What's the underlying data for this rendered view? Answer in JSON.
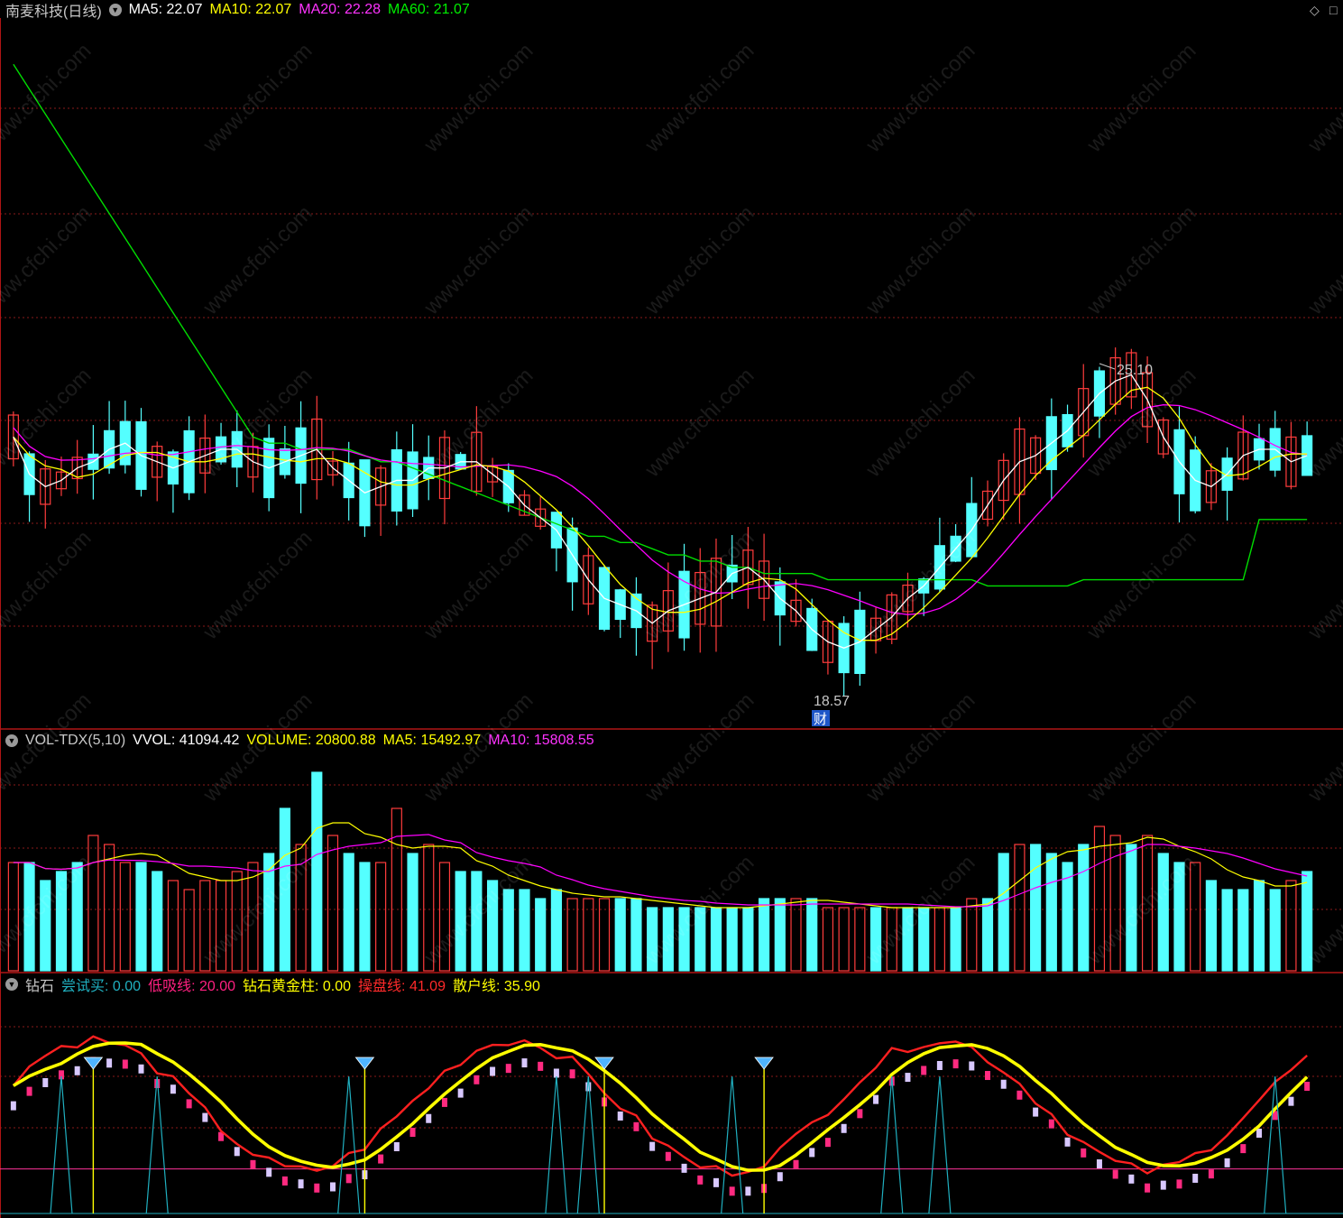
{
  "main": {
    "title": "南麦科技(日线)",
    "ma5": {
      "label": "MA5:",
      "value": "22.07",
      "color": "#ffffff"
    },
    "ma10": {
      "label": "MA10:",
      "value": "22.07",
      "color": "#ffff00"
    },
    "ma20": {
      "label": "MA20:",
      "value": "22.28",
      "color": "#ff00ff"
    },
    "ma60": {
      "label": "MA60:",
      "value": "21.07",
      "color": "#00ff00"
    },
    "high_label": "25.10",
    "low_label": "18.57",
    "fin_marker": "财"
  },
  "volume_panel": {
    "title": "VOL-TDX(5,10)",
    "vvol": "VVOL: 41094.42",
    "volume": "VOLUME: 20800.88",
    "ma5": "MA5: 15492.97",
    "ma10": "MA10: 15808.55"
  },
  "diamond_panel": {
    "title": "钻石",
    "try_buy": "尝试买: 0.00",
    "low_absorb": "低吸线: 20.00",
    "gold_bar": "钻石黄金柱: 0.00",
    "operator": "操盘线: 41.09",
    "retail": "散户线: 35.90"
  },
  "watermark": "www.cfchi.com",
  "colors": {
    "up": "#ff3c3c",
    "down": "#54ffff",
    "grid": "#8a1a1a",
    "ma5": "#ffffff",
    "ma10": "#ffff00",
    "ma20": "#ff00ff",
    "ma60": "#00dd00",
    "panel_sep": "#b01515"
  },
  "chart_data": [
    {
      "type": "candlestick",
      "series": [
        {
          "name": "MA5",
          "values": [
            22.4,
            21.8,
            21.6,
            21.7,
            21.9,
            22.0,
            22.2,
            22.3,
            22.1,
            22.0,
            21.9,
            22.0,
            22.1,
            22.2,
            22.2,
            22.0,
            21.9,
            22.0,
            22.1,
            22.2,
            21.9,
            21.7,
            21.5,
            21.6,
            21.7,
            21.7,
            21.9,
            21.9,
            22.0,
            22.0,
            21.8,
            21.6,
            21.3,
            21.1,
            20.9,
            20.5,
            20.1,
            19.8,
            19.7,
            19.6,
            19.4,
            19.6,
            19.7,
            19.8,
            19.9,
            20.2,
            20.3,
            20.1,
            19.8,
            19.6,
            19.3,
            19.1,
            19.0,
            19.1,
            19.3,
            19.5,
            19.8,
            20.0,
            20.3,
            20.6,
            20.9,
            21.3,
            21.7,
            22.0,
            22.1,
            22.3,
            22.5,
            22.8,
            23.1,
            23.3,
            23.4,
            23.0,
            22.4,
            22.0,
            21.7,
            21.6,
            21.8,
            22.1,
            22.2,
            22.2,
            22.0,
            22.1
          ]
        },
        {
          "name": "MA60",
          "values": [
            28.4,
            28.0,
            27.6,
            27.2,
            26.8,
            26.4,
            26.0,
            25.6,
            25.2,
            24.8,
            24.4,
            24.0,
            23.6,
            23.2,
            22.8,
            22.4,
            22.3,
            22.3,
            22.2,
            22.2,
            22.2,
            22.2,
            22.1,
            22.0,
            22.0,
            21.9,
            21.8,
            21.7,
            21.6,
            21.5,
            21.4,
            21.3,
            21.2,
            21.1,
            21.0,
            20.9,
            20.8,
            20.8,
            20.7,
            20.7,
            20.6,
            20.5,
            20.5,
            20.4,
            20.4,
            20.3,
            20.3,
            20.2,
            20.2,
            20.2,
            20.2,
            20.1,
            20.1,
            20.1,
            20.1,
            20.1,
            20.1,
            20.1,
            20.1,
            20.1,
            20.1,
            20.0,
            20.0,
            20.0,
            20.0,
            20.0,
            20.0,
            20.1,
            20.1,
            20.1,
            20.1,
            20.1,
            20.1,
            20.1,
            20.1,
            20.1,
            20.1,
            20.1,
            21.07,
            21.07,
            21.07,
            21.07
          ]
        }
      ],
      "price_high": 25.1,
      "price_low": 18.57,
      "note_values": [
        "MA5 22.07",
        "MA10 22.07",
        "MA20 22.28",
        "MA60 21.07"
      ]
    },
    {
      "type": "bar",
      "name": "VOL-TDX(5,10)",
      "values": [
        12,
        12,
        10,
        11,
        12,
        15,
        14,
        12,
        12,
        11,
        10,
        9,
        10,
        10,
        11,
        12,
        13,
        18,
        14,
        22,
        15,
        13,
        12,
        12,
        18,
        13,
        14,
        12,
        11,
        11,
        10,
        9,
        9,
        8,
        9,
        8,
        8,
        8,
        8,
        8,
        7,
        7,
        7,
        7,
        7,
        7,
        7,
        8,
        8,
        8,
        8,
        7,
        7,
        7,
        7,
        7,
        7,
        7,
        7,
        7,
        8,
        8,
        13,
        14,
        14,
        13,
        12,
        14,
        16,
        15,
        14,
        15,
        13,
        12,
        12,
        10,
        9,
        9,
        10,
        9,
        10,
        11
      ],
      "vvol": 41094.42,
      "volume": 20800.88,
      "ma5": 15492.97,
      "ma10": 15808.55
    },
    {
      "type": "line",
      "name": "钻石",
      "series": [
        {
          "name": "尝试买",
          "values": [
            0.0
          ]
        },
        {
          "name": "低吸线",
          "values": [
            20.0
          ]
        },
        {
          "name": "钻石黄金柱",
          "values": [
            0.0
          ]
        },
        {
          "name": "操盘线",
          "values": [
            41.09
          ]
        },
        {
          "name": "散户线",
          "values": [
            35.9
          ]
        }
      ],
      "ylim": [
        0,
        100
      ]
    }
  ]
}
